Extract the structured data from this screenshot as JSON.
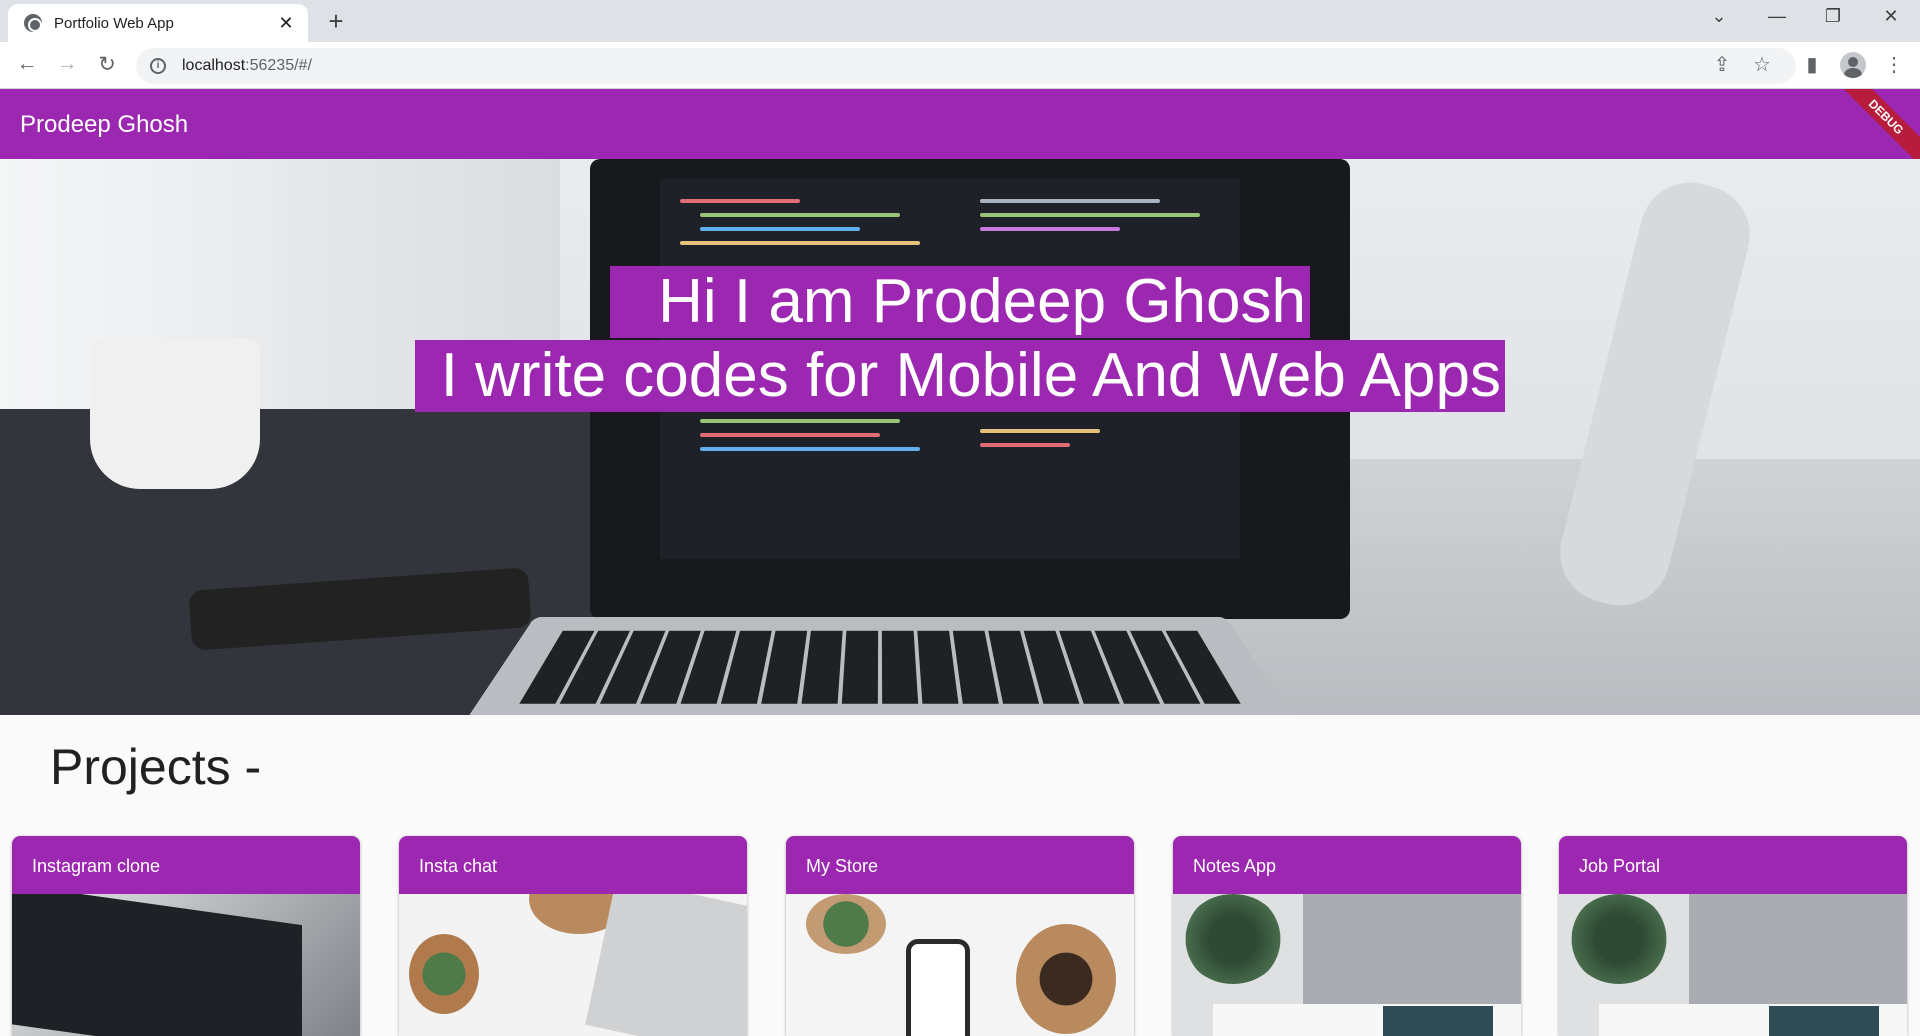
{
  "browser": {
    "tab_title": "Portfolio Web App",
    "tab_close": "✕",
    "new_tab": "+",
    "url_host": "localhost",
    "url_rest": ":56235/#/",
    "window_controls": [
      "⌄",
      "—",
      "❐",
      "✕"
    ],
    "nav": {
      "back": "←",
      "forward": "→",
      "reload": "↻"
    },
    "toolbar_icons": [
      "share-icon",
      "star-icon",
      "sidepanel-icon",
      "profile-icon",
      "more-icon"
    ]
  },
  "app": {
    "title": "Prodeep Ghosh",
    "debug_banner": "DEBUG",
    "accent_color": "#9c27b0"
  },
  "hero": {
    "line1": "Hi I am Prodeep Ghosh",
    "line2": "I write codes for Mobile And Web Apps"
  },
  "projects": {
    "heading": "Projects -",
    "items": [
      {
        "title": "Instagram clone"
      },
      {
        "title": "Insta chat"
      },
      {
        "title": "My Store"
      },
      {
        "title": "Notes App"
      },
      {
        "title": "Job Portal"
      }
    ]
  }
}
